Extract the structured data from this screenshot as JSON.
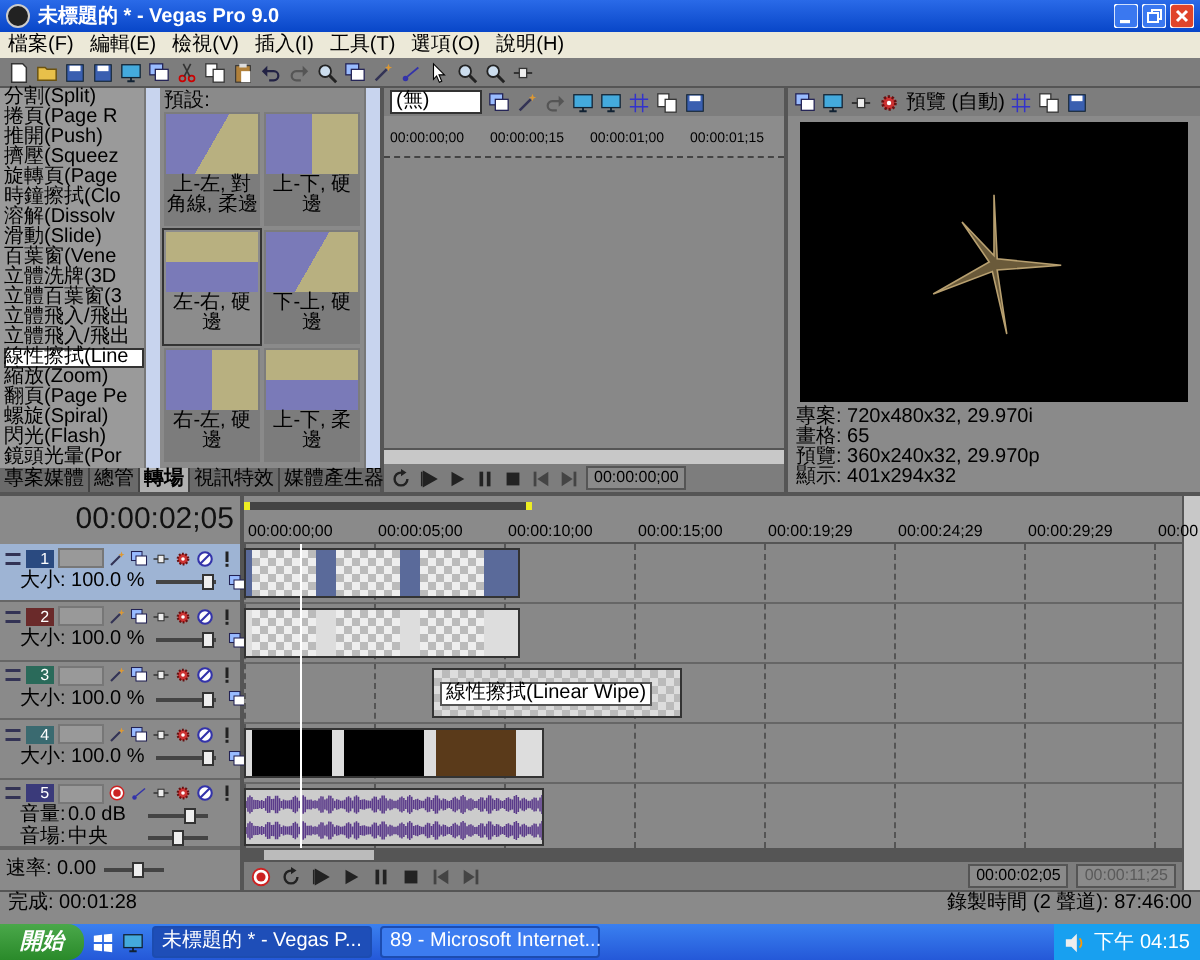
{
  "window": {
    "title": "未標題的 * - Vegas Pro 9.0"
  },
  "menu": [
    "檔案(F)",
    "編輯(E)",
    "檢視(V)",
    "插入(I)",
    "工具(T)",
    "選項(O)",
    "說明(H)"
  ],
  "transitions": {
    "items": [
      {
        "label": "分割(Split)",
        "selected": false
      },
      {
        "label": "捲頁(Page R",
        "selected": false
      },
      {
        "label": "推開(Push)",
        "selected": false
      },
      {
        "label": "擠壓(Squeez",
        "selected": false
      },
      {
        "label": "旋轉頁(Page",
        "selected": false
      },
      {
        "label": "時鐘擦拭(Clo",
        "selected": false
      },
      {
        "label": "溶解(Dissolv",
        "selected": false
      },
      {
        "label": "滑動(Slide)",
        "selected": false
      },
      {
        "label": "百葉窗(Vene",
        "selected": false
      },
      {
        "label": "立體洗牌(3D",
        "selected": false
      },
      {
        "label": "立體百葉窗(3",
        "selected": false
      },
      {
        "label": "立體飛入/飛出",
        "selected": false
      },
      {
        "label": "立體飛入/飛出",
        "selected": false
      },
      {
        "label": "線性擦拭(Line",
        "selected": true
      },
      {
        "label": "縮放(Zoom)",
        "selected": false
      },
      {
        "label": "翻頁(Page Pe",
        "selected": false
      },
      {
        "label": "螺旋(Spiral)",
        "selected": false
      },
      {
        "label": "閃光(Flash)",
        "selected": false
      },
      {
        "label": "鏡頭光暈(Por",
        "selected": false
      }
    ],
    "heading": "預設:",
    "presets": [
      {
        "label": "上-左, 對角線, 柔邊",
        "selected": false
      },
      {
        "label": "上-下, 硬邊",
        "selected": false
      },
      {
        "label": "左-右, 硬邊",
        "selected": true
      },
      {
        "label": "下-上, 硬邊",
        "selected": false
      },
      {
        "label": "右-左, 硬邊",
        "selected": false
      },
      {
        "label": "上-下, 柔邊",
        "selected": false
      }
    ]
  },
  "dock_tabs": [
    {
      "label": "專案媒體",
      "selected": false
    },
    {
      "label": "總管",
      "selected": false
    },
    {
      "label": "轉場",
      "selected": true
    },
    {
      "label": "視訊特效",
      "selected": false
    },
    {
      "label": "媒體產生器",
      "selected": false
    }
  ],
  "trimmer": {
    "dropdown": "(無)",
    "ruler": [
      "00:00:00;00",
      "00:00:00;15",
      "00:00:01;00",
      "00:00:01;15"
    ],
    "timecode": "00:00:00;00"
  },
  "preview": {
    "mode": "預覽 (自動)",
    "info": [
      "專案: 720x480x32, 29.970i",
      "畫格: 65",
      "預覽: 360x240x32, 29.970p",
      "顯示: 401x294x32"
    ]
  },
  "timeline": {
    "timecode": "00:00:02;05",
    "ruler": [
      "00:00:00;00",
      "00:00:05;00",
      "00:00:10;00",
      "00:00:15;00",
      "00:00:19;29",
      "00:00:24;29",
      "00:00:29;29",
      "00:00"
    ],
    "tracks": [
      {
        "number": "1",
        "kind": "video",
        "color": "#2a4a80",
        "selected": true,
        "size": {
          "label": "大小: 100.0 %",
          "level": 0.85
        }
      },
      {
        "number": "2",
        "kind": "video",
        "color": "#6a2a2a",
        "selected": false,
        "size": {
          "label": "大小: 100.0 %",
          "level": 0.85
        }
      },
      {
        "number": "3",
        "kind": "video",
        "color": "#2a6a5a",
        "selected": false,
        "size": {
          "label": "大小: 100.0 %",
          "level": 0.85
        },
        "transition": "線性擦拭(Linear Wipe)"
      },
      {
        "number": "4",
        "kind": "video",
        "color": "#3a6a70",
        "selected": false,
        "size": {
          "label": "大小: 100.0 %",
          "level": 0.85
        }
      },
      {
        "number": "5",
        "kind": "audio",
        "color": "#3a3a7a",
        "selected": false,
        "volume": {
          "label": "音量:",
          "value": "0.0 dB",
          "level": 0.7
        },
        "pan": {
          "label": "音場:",
          "value": "中央",
          "level": 0.5
        }
      }
    ]
  },
  "rate": {
    "label": "速率: 0.00",
    "level": 0.55
  },
  "transport": {
    "timecodes": [
      {
        "text": "00:00:02;05",
        "disabled": false
      },
      {
        "text": "00:00:11;25",
        "disabled": true
      }
    ]
  },
  "status": {
    "left": "完成: 00:01:28",
    "right": "錄製時間 (2 聲道): 87:46:00"
  },
  "taskbar": {
    "start": "開始",
    "tasks": [
      {
        "label": "未標題的 * - Vegas P...",
        "selected": true
      },
      {
        "label": "89 - Microsoft Internet...",
        "selected": false
      }
    ],
    "clock": "下午 04:15"
  }
}
